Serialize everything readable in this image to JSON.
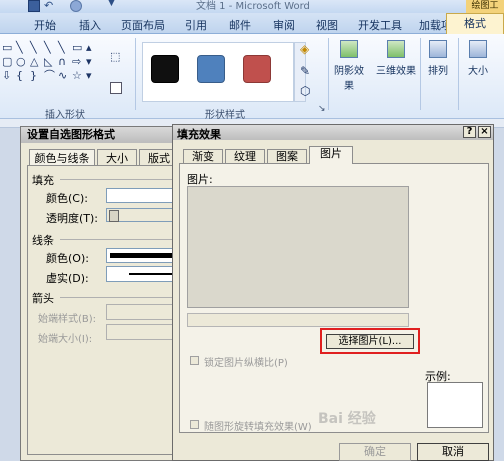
{
  "word": {
    "title": "文档 1 - Microsoft Word",
    "drawing_tools_label": "绘图工",
    "tabs": [
      "开始",
      "插入",
      "页面布局",
      "引用",
      "邮件",
      "审阅",
      "视图",
      "开发工具",
      "加载项"
    ],
    "active_tab": "格式",
    "groups": {
      "insert_shapes": "插入形状",
      "shape_styles": "形状样式"
    },
    "buttons": {
      "shadow_effects": "阴影效果",
      "3d_effects": "三维效果",
      "arrange": "排列",
      "size": "大小"
    },
    "style_swatch_colors": [
      "#101010",
      "#4f81bd",
      "#c0504d"
    ]
  },
  "back_dialog": {
    "title": "设置自选图形格式",
    "tabs": [
      "颜色与线条",
      "大小",
      "版式"
    ],
    "fill_section": "填充",
    "fill_color_label": "颜色(C):",
    "transparency_label": "透明度(T):",
    "lines_section": "线条",
    "line_color_label": "颜色(O):",
    "dash_label": "虚实(D):",
    "arrows_section": "箭头",
    "begin_style_label": "始端样式(B):",
    "begin_size_label": "始端大小(I):"
  },
  "dialog": {
    "title": "填充效果",
    "help_btn": "?",
    "close_btn": "×",
    "tabs": [
      "渐变",
      "纹理",
      "图案",
      "图片"
    ],
    "active_tab": "图片",
    "picture_label": "图片:",
    "select_picture_button": "选择图片(L)...",
    "lock_aspect_label": "锁定图片纵横比(P)",
    "rotate_with_shape_label": "随图形旋转填充效果(W)",
    "sample_label": "示例:",
    "ok_button": "确定",
    "cancel_button": "取消"
  },
  "watermark": "Bai 经验"
}
